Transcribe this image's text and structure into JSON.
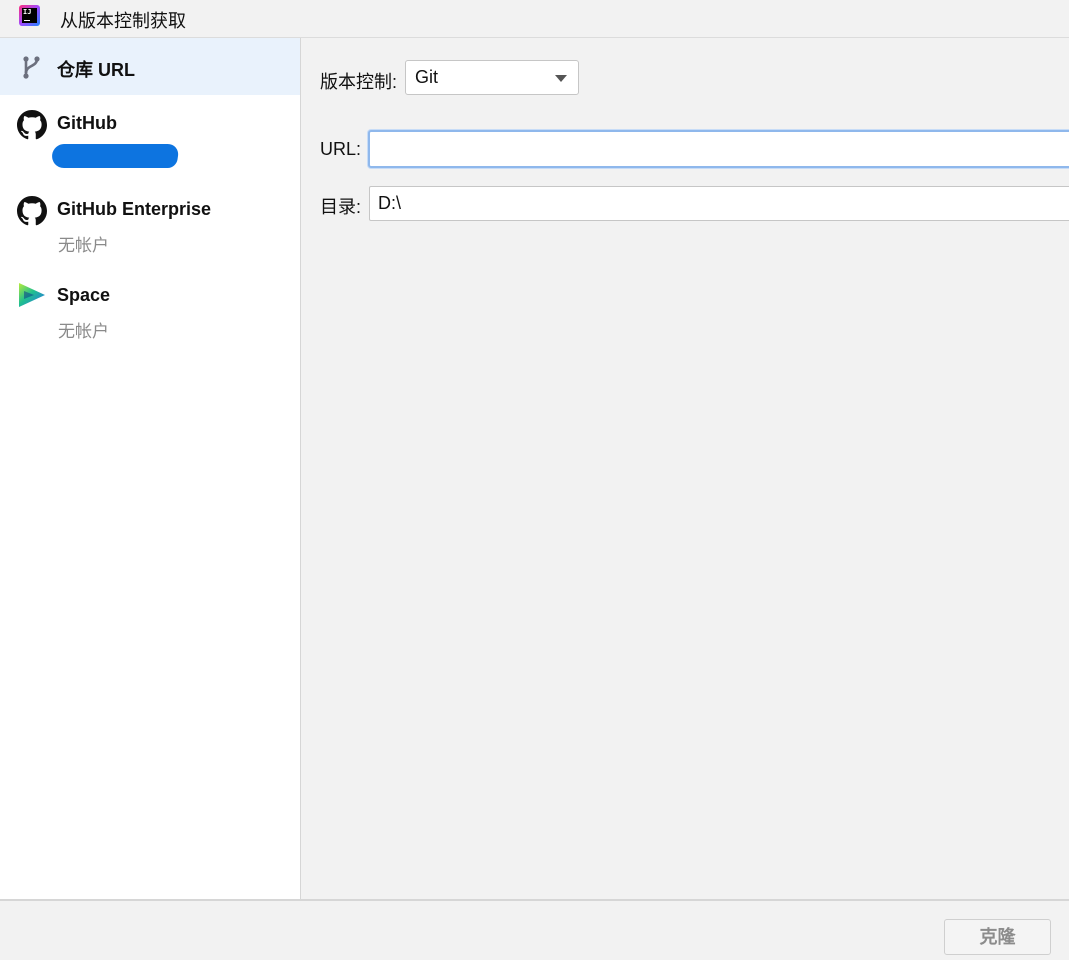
{
  "window": {
    "title": "从版本控制获取"
  },
  "sidebar": {
    "items": [
      {
        "label": "仓库 URL",
        "icon": "vcs-branch-icon",
        "selected": true
      },
      {
        "label": "GitHub",
        "icon": "github-icon",
        "sub": ""
      },
      {
        "label": "GitHub Enterprise",
        "icon": "github-icon",
        "sub": "无帐户"
      },
      {
        "label": "Space",
        "icon": "space-icon",
        "sub": "无帐户"
      }
    ]
  },
  "main": {
    "vcs_label": "版本控制:",
    "vcs_value": "Git",
    "url_label": "URL:",
    "url_value": "",
    "dir_label": "目录:",
    "dir_value": "D:\\"
  },
  "footer": {
    "clone_label": "克隆"
  },
  "colors": {
    "selected_bg": "#e9f2fc",
    "focus_border": "#8fb8ec",
    "redaction": "#0d74e0",
    "muted_text": "#8a8a8a"
  }
}
